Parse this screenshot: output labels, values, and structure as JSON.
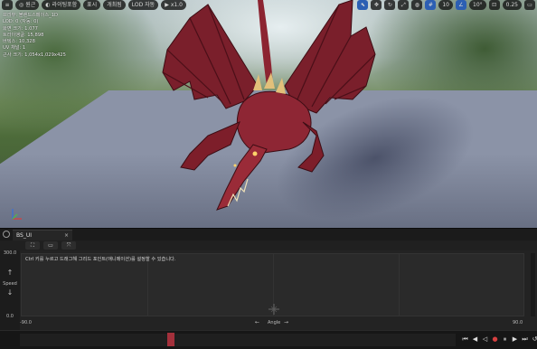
{
  "viewport": {
    "toolbar_left": [
      {
        "icon": "menu-icon",
        "label": ""
      },
      {
        "icon": "perspective-icon",
        "label": "원근"
      },
      {
        "icon": "lit-icon",
        "label": "라이팅포함"
      },
      {
        "icon": "show-icon",
        "label": "표시"
      },
      {
        "icon": "hidden-icon",
        "label": "개최됨"
      },
      {
        "icon": "lod-icon",
        "label": "LOD 자동"
      },
      {
        "icon": "play-speed-icon",
        "label": "x1.0"
      }
    ],
    "toolbar_right": [
      {
        "icon": "select-icon"
      },
      {
        "icon": "move-icon"
      },
      {
        "icon": "rotate-icon"
      },
      {
        "icon": "scale-icon"
      },
      {
        "icon": "world-icon"
      },
      {
        "icon": "snap-icon"
      },
      {
        "icon": "grid-snap-value",
        "label": "10"
      },
      {
        "icon": "angle-snap-icon"
      },
      {
        "icon": "angle-snap-value",
        "label": "10°"
      },
      {
        "icon": "scale-snap-icon"
      },
      {
        "icon": "scale-snap-value",
        "label": "0.25"
      },
      {
        "icon": "camera-speed-icon"
      }
    ],
    "stats": [
      "프리뷰: 블렌드스페이스_1D",
      "LOD: 0 (자동: 0)",
      "화면 크기: 1.077",
      "트라이앵글: 15,898",
      "버텍스: 10,328",
      "UV 채널: 1",
      "근사 크기: 1,054x1,029x425"
    ]
  },
  "panel": {
    "tab_label": "BS_UI",
    "tab_close": "×",
    "hint_text": "Ctrl 키를 누르고 드래그해 그리드 포인트(애니메이션)를 설정할 수 있습니다.",
    "y_axis": {
      "label": "Speed",
      "max": "300.0",
      "min": "0.0"
    },
    "x_axis": {
      "label": "Angle",
      "min": "-90.0",
      "max": "90.0"
    }
  },
  "colors": {
    "accent": "#2c5fb3",
    "record": "#d64040",
    "playhead": "#a3303b"
  }
}
